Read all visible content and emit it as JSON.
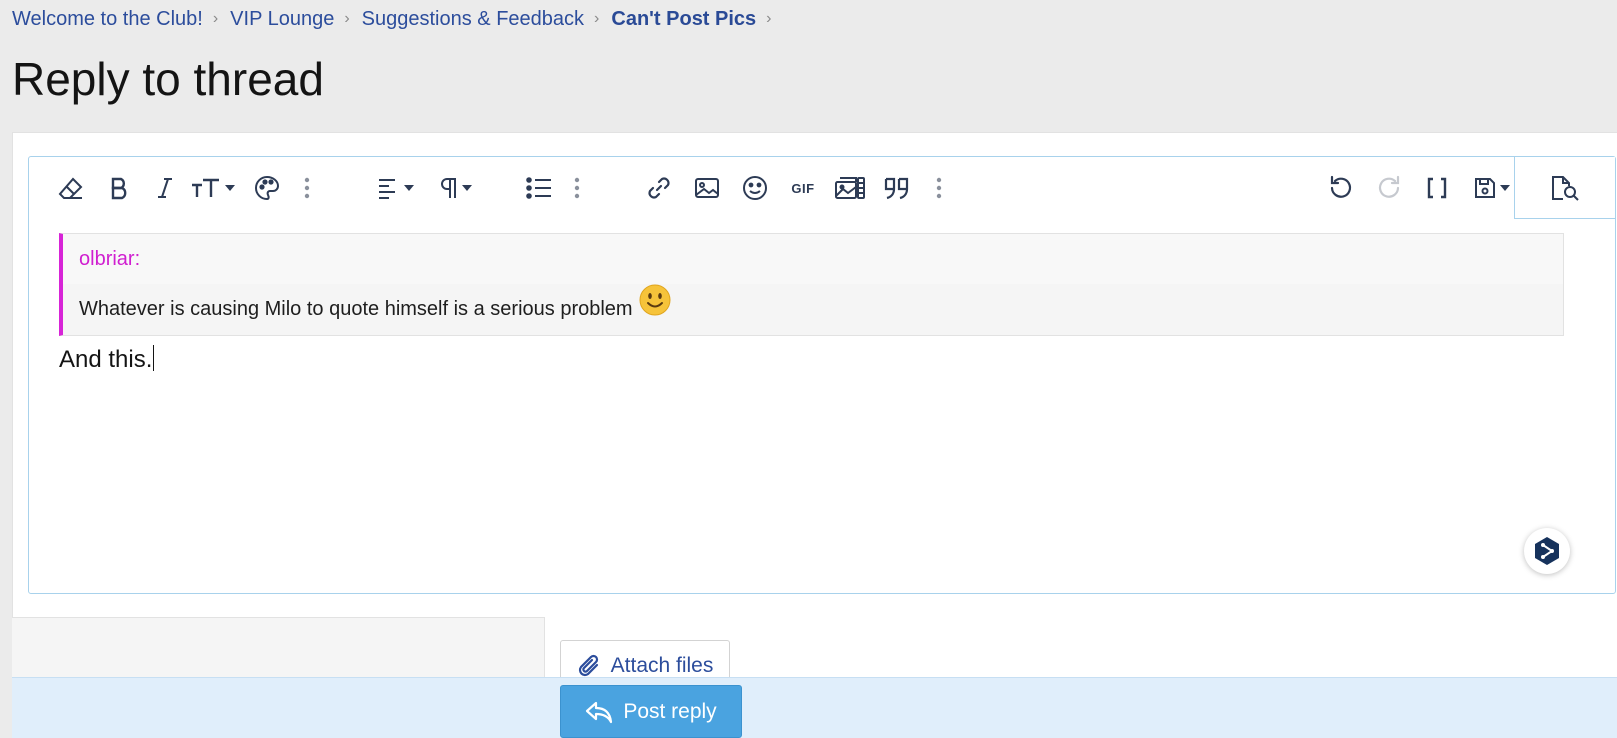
{
  "breadcrumb": {
    "items": [
      "Welcome to the Club!",
      "VIP Lounge",
      "Suggestions & Feedback",
      "Can't Post Pics"
    ],
    "separator": "›"
  },
  "page_title": "Reply to thread",
  "toolbar": {
    "icons": [
      "eraser-icon",
      "bold-icon",
      "italic-icon",
      "font-size-icon",
      "color-palette-icon",
      "more-vertical-icon",
      "align-icon",
      "paragraph-icon",
      "list-icon",
      "more-vertical-icon",
      "link-icon",
      "image-icon",
      "emoji-icon",
      "gif-icon",
      "media-icon",
      "quote-icon",
      "more-vertical-icon",
      "undo-icon",
      "redo-icon",
      "bbcode-icon",
      "drafts-icon",
      "preview-icon"
    ],
    "gif_label": "GIF"
  },
  "editor": {
    "quote_author": "olbriar:",
    "quote_text": "Whatever is causing Milo to quote himself is a serious problem",
    "body": "And this."
  },
  "attach_label": "Attach files",
  "submit_label": "Post reply",
  "colors": {
    "link": "#2c4d9c",
    "quote_accent": "#d724d7",
    "button": "#4aa3e0"
  }
}
